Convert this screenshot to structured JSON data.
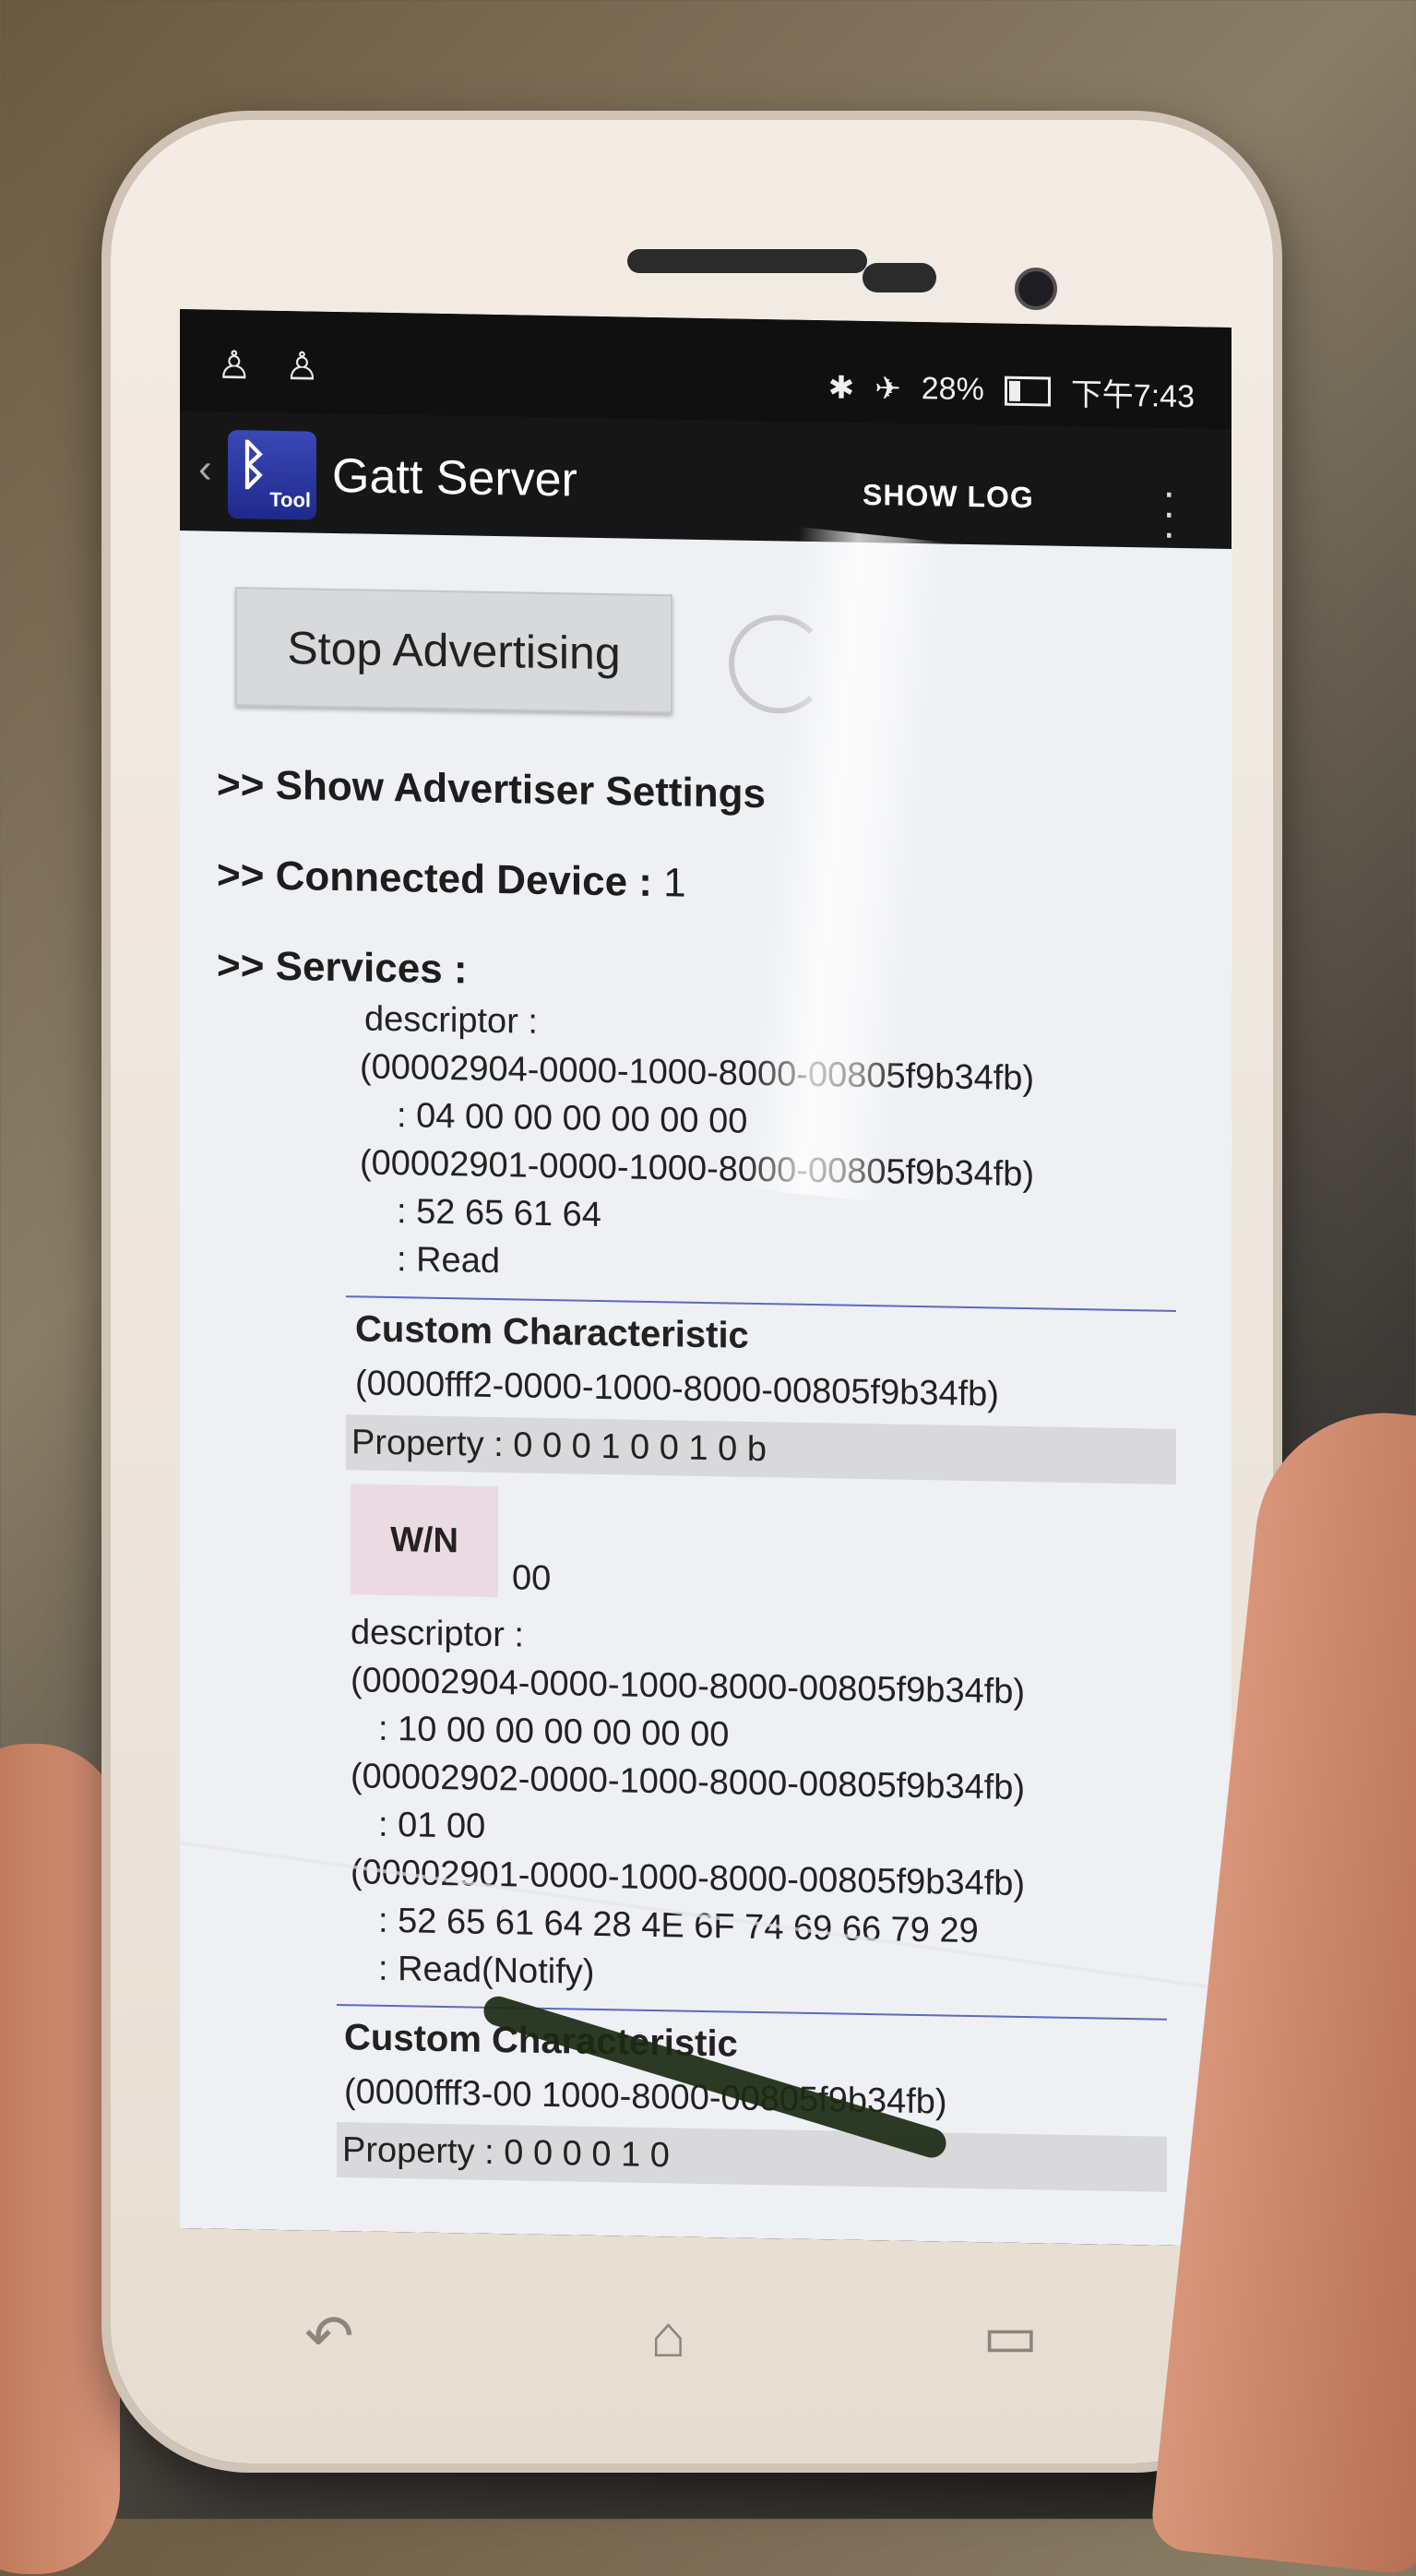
{
  "status_bar": {
    "left_icons": [
      "keyhole-icon",
      "keyhole-icon"
    ],
    "bluetooth_icon": "bluetooth-icon",
    "airplane_icon": "airplane-icon",
    "battery_percent": "28%",
    "time": "下午7:43"
  },
  "action_bar": {
    "title": "Gatt Server",
    "app_icon_label": "Tool",
    "show_log": "SHOW LOG"
  },
  "main": {
    "stop_button": "Stop Advertising",
    "advertiser_settings": ">> Show Advertiser Settings",
    "connected_label": ">> Connected Device : ",
    "connected_count": "1",
    "services_label": ">> Services :",
    "block1": {
      "descriptor_label": "descriptor :",
      "uuid_a": "(00002904-0000-1000-8000-00805f9b34fb)",
      "value_a": ": 04 00 00 00 00 00 00",
      "uuid_b": "(00002901-0000-1000-8000-00805f9b34fb)",
      "value_b": ": 52 65 61 64",
      "value_c": ": Read"
    },
    "char2": {
      "title": "Custom Characteristic",
      "uuid": "(0000fff2-0000-1000-8000-00805f9b34fb)",
      "property": "Property :  0 0 0 1 0 0 1 0 b",
      "wn_button": "W/N",
      "value": "00",
      "descriptor_label": "descriptor :",
      "d1_uuid": "(00002904-0000-1000-8000-00805f9b34fb)",
      "d1_value": ": 10 00 00 00 00 00 00",
      "d2_uuid": "(00002902-0000-1000-8000-00805f9b34fb)",
      "d2_value": ": 01 00",
      "d3_uuid": "(00002901-0000-1000-8000-00805f9b34fb)",
      "d3_value": ": 52 65 61 64 28 4E 6F 74 69 66 79 29",
      "d3_text": ": Read(Notify)"
    },
    "char3": {
      "title": "Custom Characteristic",
      "uuid": "(0000fff3-00   1000-8000-00805f9b34fb)",
      "property": "Property :  0 0 0 0 1 0"
    }
  },
  "nav": {
    "back": "back-icon",
    "home": "home-icon",
    "recents": "recents-icon"
  }
}
